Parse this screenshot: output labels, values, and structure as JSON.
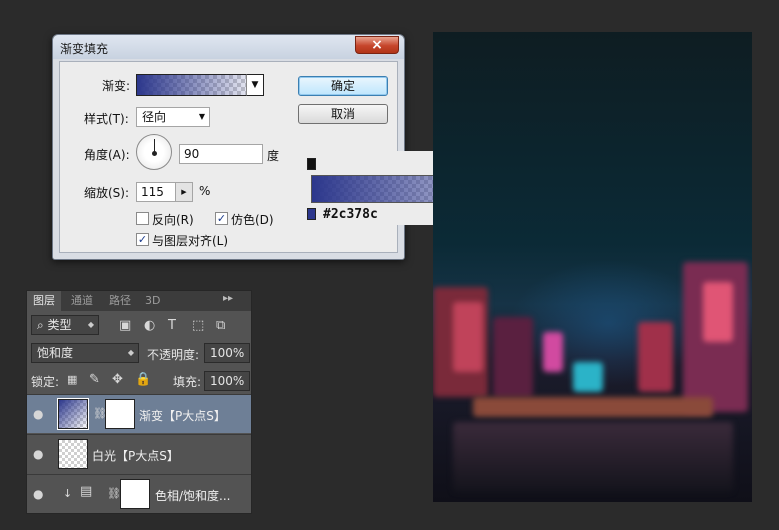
{
  "dialog": {
    "title": "渐变填充",
    "close_glyph": "×",
    "gradient_label": "渐变:",
    "style_label": "样式(T):",
    "style_value": "径向",
    "angle_label": "角度(A):",
    "angle_value": "90",
    "angle_unit": "度",
    "scale_label": "缩放(S):",
    "scale_value": "115",
    "scale_unit": "%",
    "reverse_label": "反向(R)",
    "reverse_checked": false,
    "dither_label": "仿色(D)",
    "dither_checked": true,
    "align_label": "与图层对齐(L)",
    "align_checked": true,
    "ok_label": "确定",
    "cancel_label": "取消",
    "checkmark": "✓"
  },
  "gradient_editor": {
    "color_stop_hex": "#2c378c",
    "gradient_color": "#2c378c"
  },
  "layers_panel": {
    "tabs": [
      "图层",
      "通道",
      "路径",
      "3D"
    ],
    "tab_menu_glyph": "▸▸",
    "filter_kind": "类型",
    "blend_mode": "饱和度",
    "opacity_label": "不透明度:",
    "opacity_value": "100%",
    "lock_label": "锁定:",
    "fill_label": "填充:",
    "fill_value": "100%",
    "layers": [
      {
        "name": "渐变【P大点S】",
        "selected": true
      },
      {
        "name": "白光【P大点S】",
        "selected": false
      },
      {
        "name": "色相/饱和度...",
        "selected": false
      }
    ]
  }
}
